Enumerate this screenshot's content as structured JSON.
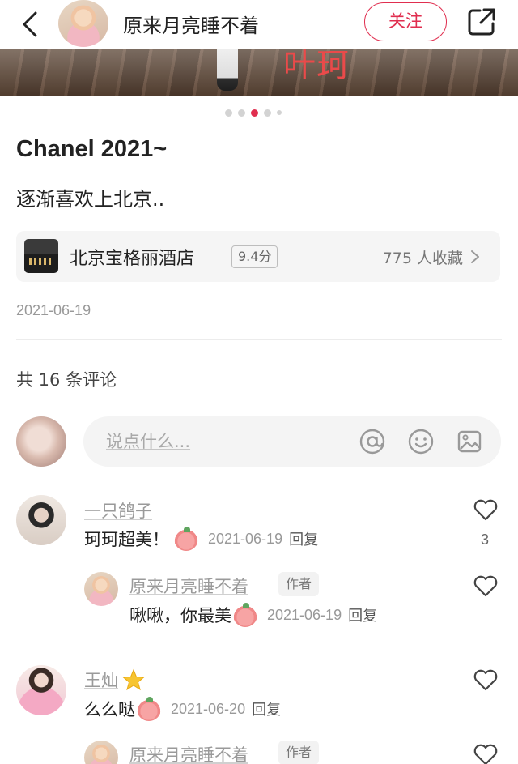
{
  "header": {
    "author_name": "原来月亮睡不着",
    "follow_label": "关注"
  },
  "photo": {
    "watermark": "叶珂"
  },
  "carousel": {
    "count": 5,
    "active": 3
  },
  "post": {
    "title": "Chanel 2021~",
    "body": "逐渐喜欢上北京..",
    "date": "2021-06-19"
  },
  "place": {
    "name": "北京宝格丽酒店",
    "score": "9.4分",
    "favorites": "775 人收藏"
  },
  "comments_header": {
    "count_text": "共 16 条评论"
  },
  "comment_input": {
    "placeholder": "说点什么..."
  },
  "comments": [
    {
      "user": "一只鸽子",
      "text": "珂珂超美！",
      "date": "2021-06-19",
      "reply_label": "回复",
      "likes": "3",
      "replies": [
        {
          "user": "原来月亮睡不着",
          "tag": "作者",
          "text": "啾啾，你最美",
          "date": "2021-06-19",
          "reply_label": "回复"
        }
      ]
    },
    {
      "user": "王灿",
      "text": "么么哒",
      "date": "2021-06-20",
      "reply_label": "回复",
      "replies": [
        {
          "user": "原来月亮睡不着",
          "tag": "作者"
        }
      ]
    }
  ],
  "icons": [
    "back-arrow-icon",
    "share-icon",
    "chevron-right-icon",
    "at-icon",
    "smiley-icon",
    "image-icon",
    "heart-icon",
    "star-badge-icon",
    "kiss-emoji-icon"
  ],
  "colors": {
    "accent": "#e02e4f",
    "watermark": "#ea4a4a"
  }
}
